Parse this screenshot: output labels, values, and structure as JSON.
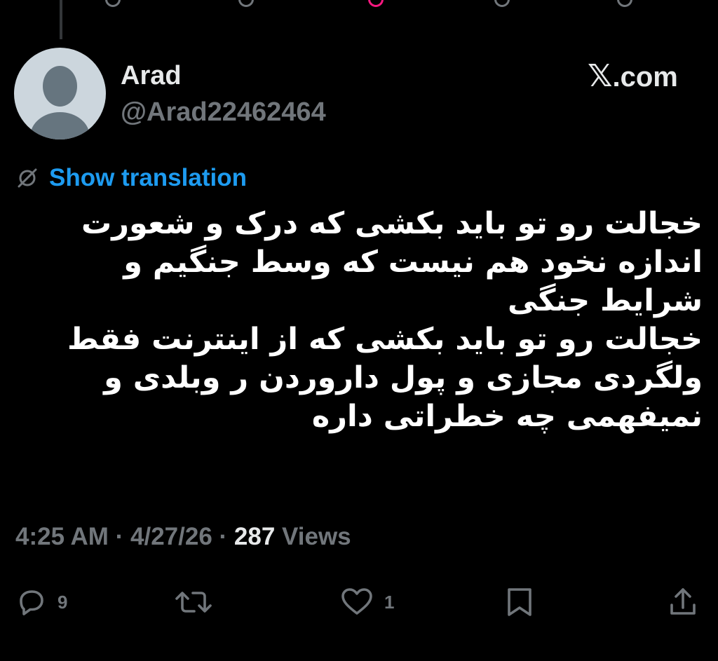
{
  "header": {
    "display_name": "Arad",
    "handle": "@Arad22462464",
    "brand_x": "𝕏",
    "brand_suffix": ".com"
  },
  "translate": {
    "icon": "no-translate-icon",
    "label": "Show translation"
  },
  "tweet": {
    "lines": [
      "خجالت رو تو باید بکشی که درک و شعورت",
      "اندازه نخود هم نیست که وسط جنگیم و",
      "شرایط جنگی",
      "خجالت رو تو باید بکشی که از اینترنت فقط",
      "ولگردی مجازی و پول داروردن ر وبلدی و",
      "نمیفهمی چه خطراتی داره"
    ]
  },
  "meta": {
    "time": "4:25 AM",
    "sep1": " · ",
    "date": "4/27/26",
    "sep2": " · ",
    "views_count": "287",
    "views_label": " Views"
  },
  "actions": {
    "reply": {
      "icon": "reply-icon",
      "count": "9"
    },
    "repost": {
      "icon": "repost-icon",
      "count": ""
    },
    "like": {
      "icon": "heart-icon",
      "count": "1"
    },
    "bookmark": {
      "icon": "bookmark-icon"
    },
    "share": {
      "icon": "share-icon"
    }
  },
  "colors": {
    "background": "#000000",
    "primary_text": "#e7e9ea",
    "secondary_text": "#71767b",
    "link": "#1d9bf0",
    "avatar_bg": "#ccd6dd",
    "avatar_fg": "#66757f"
  }
}
